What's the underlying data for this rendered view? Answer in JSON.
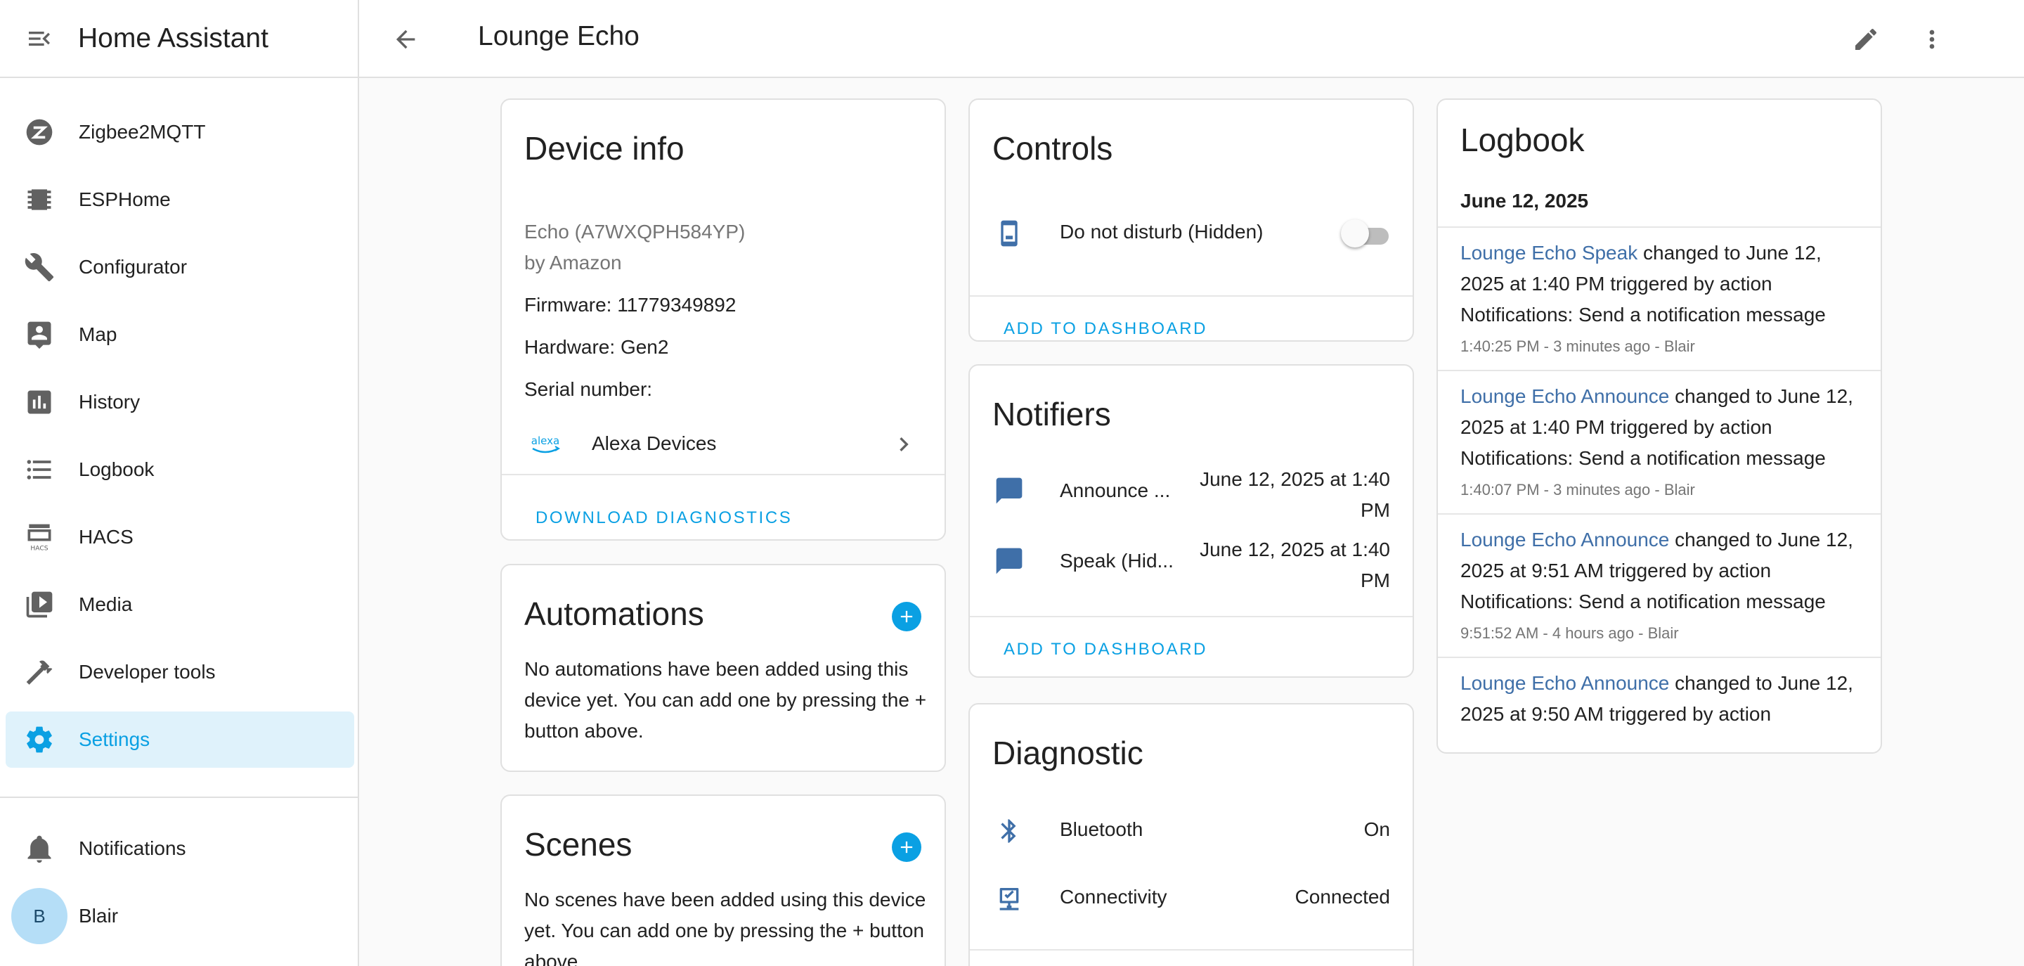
{
  "app": {
    "title": "Home Assistant"
  },
  "sidebar": {
    "items": [
      {
        "label": "Zigbee2MQTT",
        "icon": "zigbee-icon"
      },
      {
        "label": "ESPHome",
        "icon": "chip-icon"
      },
      {
        "label": "Configurator",
        "icon": "wrench-icon"
      },
      {
        "label": "Map",
        "icon": "map-icon"
      },
      {
        "label": "History",
        "icon": "chart-icon"
      },
      {
        "label": "Logbook",
        "icon": "list-icon"
      },
      {
        "label": "HACS",
        "icon": "hacs-icon"
      },
      {
        "label": "Media",
        "icon": "media-icon"
      },
      {
        "label": "Developer tools",
        "icon": "hammer-icon"
      },
      {
        "label": "Settings",
        "icon": "gear-icon",
        "active": true
      }
    ],
    "notifications_label": "Notifications",
    "user": {
      "initial": "B",
      "name": "Blair"
    }
  },
  "topbar": {
    "title": "Lounge Echo"
  },
  "device_info": {
    "title": "Device info",
    "model": "Echo (A7WXQPH584YP)",
    "manufacturer": "by Amazon",
    "firmware": "Firmware: 11779349892",
    "hardware": "Hardware: Gen2",
    "serial": "Serial number:",
    "integration": "Alexa Devices",
    "integration_logo": "alexa",
    "action": "DOWNLOAD DIAGNOSTICS"
  },
  "automations": {
    "title": "Automations",
    "empty_text": "No automations have been added using this device yet. You can add one by pressing the + button above."
  },
  "scenes": {
    "title": "Scenes",
    "empty_text": "No scenes have been added using this device yet. You can add one by pressing the + button above."
  },
  "controls": {
    "title": "Controls",
    "entities": [
      {
        "name": "Do not disturb (Hidden)",
        "icon": "phone-icon",
        "state": "off"
      }
    ],
    "action": "ADD TO DASHBOARD"
  },
  "notifiers": {
    "title": "Notifiers",
    "entities": [
      {
        "name": "Announce ...",
        "value_line1": "June 12, 2025 at 1:40",
        "value_line2": "PM"
      },
      {
        "name": "Speak (Hid...",
        "value_line1": "June 12, 2025 at 1:40",
        "value_line2": "PM"
      }
    ],
    "action": "ADD TO DASHBOARD"
  },
  "diagnostic": {
    "title": "Diagnostic",
    "entities": [
      {
        "name": "Bluetooth",
        "value": "On",
        "icon": "bluetooth-icon"
      },
      {
        "name": "Connectivity",
        "value": "Connected",
        "icon": "connectivity-icon"
      }
    ]
  },
  "logbook": {
    "title": "Logbook",
    "date": "June 12, 2025",
    "entries": [
      {
        "entity": "Lounge Echo Speak",
        "line1_rest": " changed to June 12,",
        "line2": "2025 at 1:40 PM triggered by action",
        "line3": "Notifications: Send a notification message",
        "meta": "1:40:25 PM - 3 minutes ago - Blair"
      },
      {
        "entity": "Lounge Echo Announce",
        "line1_rest": " changed to June 12,",
        "line2": "2025 at 1:40 PM triggered by action",
        "line3": "Notifications: Send a notification message",
        "meta": "1:40:07 PM - 3 minutes ago - Blair"
      },
      {
        "entity": "Lounge Echo Announce",
        "line1_rest": " changed to June 12,",
        "line2": "2025 at 9:51 AM triggered by action",
        "line3": "Notifications: Send a notification message",
        "meta": "9:51:52 AM - 4 hours ago - Blair"
      },
      {
        "entity": "Lounge Echo Announce",
        "line1_rest": " changed to June 12,",
        "line2": "2025 at 9:50 AM triggered by action"
      }
    ]
  },
  "colors": {
    "accent": "#0aa0e3",
    "active_bg": "#dff2fb",
    "entity_link": "#3f6fa8",
    "icon_blue": "#3f6fa8",
    "icon_gray": "#616161"
  }
}
